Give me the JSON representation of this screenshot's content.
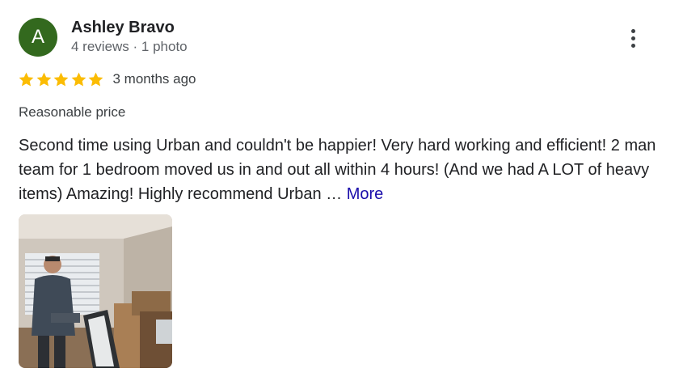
{
  "reviewer": {
    "initial": "A",
    "name": "Ashley Bravo",
    "meta": "4 reviews · 1 photo",
    "avatar_color": "#33691e"
  },
  "menu": {
    "icon": "more-vert-icon"
  },
  "rating": {
    "value": 5,
    "max": 5,
    "star_color": "#fbbc04",
    "date": "3 months ago"
  },
  "tag": "Reasonable price",
  "review": {
    "text": "Second time using Urban and couldn't be happier! Very hard working and efficient! 2 man team for 1 bedroom moved us in and out all within 4 hours! (And we had A LOT of heavy items) Amazing! Highly recommend Urban …",
    "more_label": "More",
    "link_color": "#1a0dab"
  },
  "photo": {
    "subject": "person holding items in a room with boxes"
  }
}
